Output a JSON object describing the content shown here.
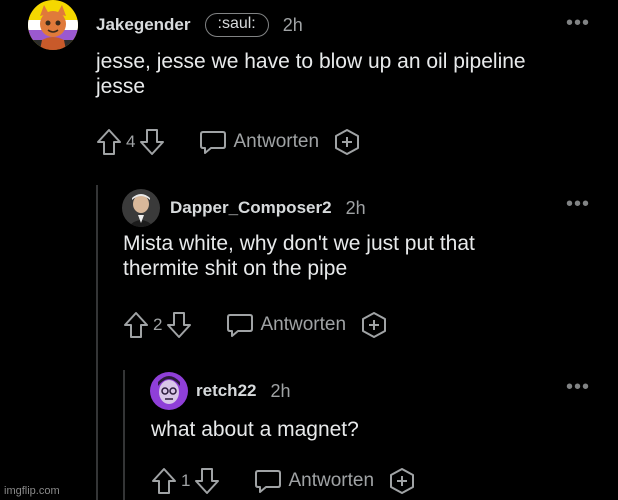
{
  "comments": [
    {
      "username": "Jakegender",
      "flair": ":saul:",
      "time": "2h",
      "text_line1": "jesse, jesse we have to blow up an oil pipeline",
      "text_line2": "jesse",
      "votes": "4",
      "reply_label": "Antworten"
    },
    {
      "username": "Dapper_Composer2",
      "time": "2h",
      "text_line1": "Mista white, why don't we just put that",
      "text_line2": "thermite shit on the pipe",
      "votes": "2",
      "reply_label": "Antworten"
    },
    {
      "username": "retch22",
      "time": "2h",
      "text_line1": "what about a magnet?",
      "votes": "1",
      "reply_label": "Antworten"
    }
  ],
  "more_glyph": "•••",
  "watermark": "imgflip.com",
  "colors": {
    "background": "#000000",
    "text": "#d7dadc",
    "muted": "#a0a3a5",
    "thread_line": "#343536"
  }
}
